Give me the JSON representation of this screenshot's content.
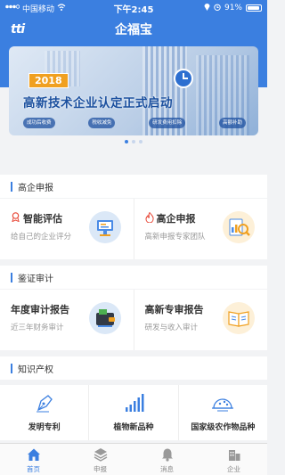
{
  "status_bar": {
    "carrier": "中国移动",
    "time": "下午2:45",
    "battery": "91%",
    "battery_level": 0.91
  },
  "navbar": {
    "logo": "tti",
    "title": "企福宝"
  },
  "banner": {
    "year": "2018",
    "headline": "高新技术企业认定正式启动",
    "tags": [
      "成功后收费",
      "税收减免",
      "研发费用扣除",
      "高额补助"
    ],
    "dots_count": 3,
    "active_dot": 1
  },
  "sections": {
    "high_tech": {
      "label": "高企申报",
      "cards": [
        {
          "title": "智能评估",
          "subtitle": "给自己的企业评分",
          "icon": "badge-icon"
        },
        {
          "title": "高企申报",
          "subtitle": "高新申报专家团队",
          "icon": "flame-icon"
        }
      ]
    },
    "audit": {
      "label": "鉴证审计",
      "cards": [
        {
          "title": "年度审计报告",
          "subtitle": "近三年财务审计"
        },
        {
          "title": "高新专审报告",
          "subtitle": "研发与收入审计"
        }
      ]
    },
    "ip": {
      "label": "知识产权",
      "items": [
        {
          "label": "发明专利",
          "icon": "pen-nib-icon"
        },
        {
          "label": "植物新品种",
          "icon": "signal-bars-icon"
        },
        {
          "label": "国家级农作物品种",
          "icon": "plant-dome-icon"
        }
      ]
    }
  },
  "tabbar": {
    "tabs": [
      {
        "label": "首页",
        "icon": "home-icon",
        "active": true
      },
      {
        "label": "申报",
        "icon": "layers-icon",
        "active": false
      },
      {
        "label": "消息",
        "icon": "bell-icon",
        "active": false
      },
      {
        "label": "企业",
        "icon": "building-icon",
        "active": false
      }
    ]
  },
  "colors": {
    "primary": "#3b7fe0",
    "accent_red": "#e84a3a",
    "background": "#f2f3f5"
  }
}
